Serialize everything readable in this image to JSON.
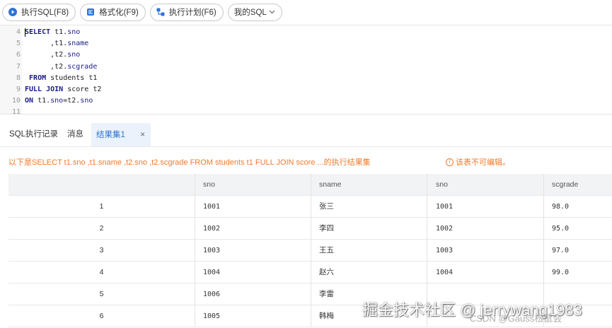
{
  "toolbar": {
    "run_label": "执行SQL(F8)",
    "format_label": "格式化(F9)",
    "plan_label": "执行计划(F6)",
    "my_sql_label": "我的SQL",
    "run_icon": "play-circle-icon",
    "format_icon": "format-icon",
    "plan_icon": "execution-plan-icon",
    "accent": "#2d74d5"
  },
  "editor": {
    "lines": [
      {
        "no": "4",
        "parts": [
          [
            "kw",
            "SELECT"
          ],
          [
            "t",
            " t1."
          ],
          [
            "id",
            "sno"
          ]
        ]
      },
      {
        "no": "5",
        "parts": [
          [
            "t",
            "      ,t1."
          ],
          [
            "id",
            "sname"
          ]
        ]
      },
      {
        "no": "6",
        "parts": [
          [
            "t",
            "      ,t2."
          ],
          [
            "id",
            "sno"
          ]
        ]
      },
      {
        "no": "7",
        "parts": [
          [
            "t",
            "      ,t2."
          ],
          [
            "id",
            "scgrade"
          ]
        ]
      },
      {
        "no": "8",
        "parts": [
          [
            "t",
            " "
          ],
          [
            "kw",
            "FROM"
          ],
          [
            "t",
            " students t1"
          ]
        ]
      },
      {
        "no": "9",
        "parts": [
          [
            "kw",
            "FULL JOIN"
          ],
          [
            "t",
            " score t2"
          ]
        ]
      },
      {
        "no": "10",
        "parts": [
          [
            "kw",
            "ON"
          ],
          [
            "t",
            " t1."
          ],
          [
            "id",
            "sno"
          ],
          [
            "t",
            "=t2."
          ],
          [
            "id",
            "sno"
          ]
        ]
      },
      {
        "no": "11",
        "parts": []
      }
    ]
  },
  "tabs": {
    "history": "SQL执行记录",
    "messages": "消息",
    "result": "结果集1",
    "close": "×"
  },
  "result": {
    "info_text": "以下是SELECT t1.sno ,t1.sname ,t2.sno ,t2.scgrade FROM students t1 FULL JOIN score ...的执行结果集",
    "warn_icon": "info-circle-icon",
    "warn_glyph": "i",
    "warn_text": "该表不可编辑。",
    "warn_color": "#f07a2c",
    "columns": [
      "",
      "sno",
      "sname",
      "sno",
      "scgrade"
    ],
    "rows": [
      [
        "1",
        "1001",
        "张三",
        "1001",
        "98.0"
      ],
      [
        "2",
        "1002",
        "李四",
        "1002",
        "95.0"
      ],
      [
        "3",
        "1003",
        "王五",
        "1003",
        "97.0"
      ],
      [
        "4",
        "1004",
        "赵六",
        "1004",
        "99.0"
      ],
      [
        "5",
        "1006",
        "李雷",
        "",
        ""
      ],
      [
        "6",
        "1005",
        "韩梅",
        "",
        ""
      ]
    ]
  },
  "watermark": {
    "main": "掘金技术社区 @ jerrywang1983",
    "sub": "CSDN @Gauss松鼠会"
  }
}
